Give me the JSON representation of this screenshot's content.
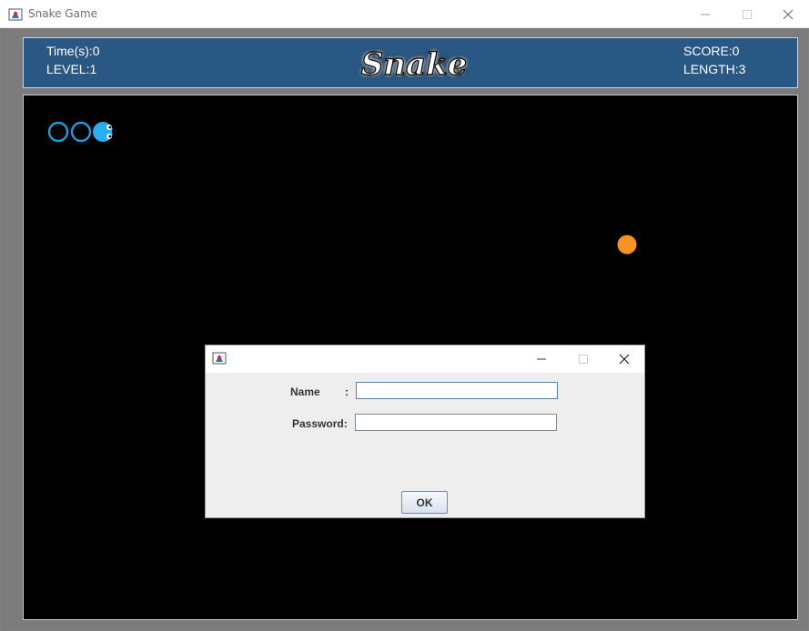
{
  "window": {
    "title": "Snake Game"
  },
  "header": {
    "time_label": "Time(s):0",
    "level_label": "LEVEL:1",
    "score_label": "SCORE:0",
    "length_label": "LENGTH:3",
    "logo_text": "Snake"
  },
  "colors": {
    "header_bg": "#2a5885",
    "board_bg": "#000000",
    "snake": "#1a9fe0",
    "food": "#f7931e",
    "dialog_bg": "#eeeeee"
  },
  "game": {
    "snake_segments": 3,
    "food_visible": true
  },
  "dialog": {
    "name_label": "Name",
    "name_colon": ":",
    "password_label": "Password:",
    "name_value": "",
    "password_value": "",
    "ok_label": "OK"
  }
}
